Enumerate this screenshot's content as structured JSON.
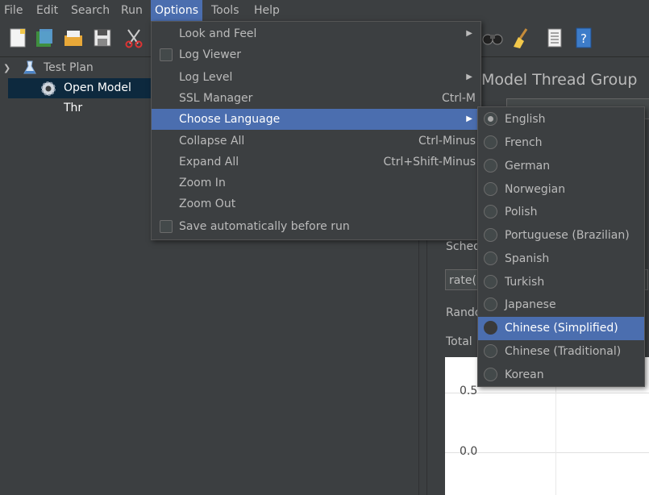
{
  "menubar": {
    "file": "File",
    "edit": "Edit",
    "search": "Search",
    "run": "Run",
    "options": "Options",
    "tools": "Tools",
    "help": "Help"
  },
  "tree": {
    "test_plan": "Test Plan",
    "thread_group": "Open Model Thr"
  },
  "panel": {
    "title": "Model Thread Group",
    "schedule_label": "Sched",
    "schedule_value": "rate(",
    "random_label": "Rando",
    "total_label": "Total",
    "graph_tick_high": "0.5",
    "graph_tick_low": "0.0"
  },
  "options_menu": {
    "items": [
      {
        "label": "Look and Feel",
        "accel": "",
        "submenu": true
      },
      {
        "label": "Log Viewer",
        "accel": "",
        "check": true
      },
      {
        "label": "Log Level",
        "accel": "",
        "submenu": true
      },
      {
        "label": "SSL Manager",
        "accel": "Ctrl-M"
      },
      {
        "label": "Choose Language",
        "accel": "",
        "submenu": true
      },
      {
        "label": "Collapse All",
        "accel": "Ctrl-Minus"
      },
      {
        "label": "Expand All",
        "accel": "Ctrl+Shift-Minus"
      },
      {
        "label": "Zoom In",
        "accel": ""
      },
      {
        "label": "Zoom Out",
        "accel": ""
      },
      {
        "label": "Save automatically before run",
        "accel": "",
        "check": true
      }
    ]
  },
  "language_menu": {
    "items": [
      "English",
      "French",
      "German",
      "Norwegian",
      "Polish",
      "Portuguese (Brazilian)",
      "Spanish",
      "Turkish",
      "Japanese",
      "Chinese (Simplified)",
      "Chinese (Traditional)",
      "Korean"
    ],
    "selected": "English",
    "highlighted": "Chinese (Simplified)"
  },
  "colors": {
    "menu_highlight": "#4b6eaf",
    "background": "#3c3f41",
    "tree_selection": "#0d293e"
  }
}
